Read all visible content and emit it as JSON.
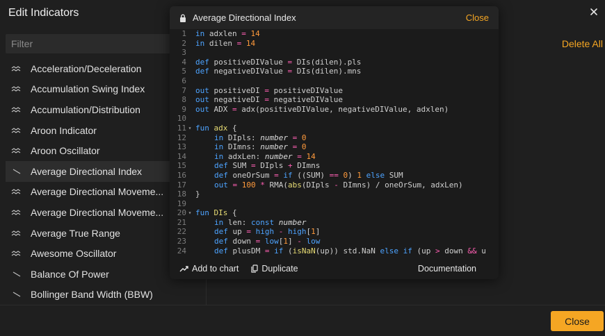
{
  "dialog": {
    "title": "Edit Indicators",
    "delete_all": "Delete All",
    "close_label": "Close"
  },
  "filter": {
    "placeholder": "Filter",
    "value": ""
  },
  "indicators": [
    "Acceleration/Deceleration",
    "Accumulation Swing Index",
    "Accumulation/Distribution",
    "Aroon Indicator",
    "Aroon Oscillator",
    "Average Directional Index",
    "Average Directional Moveme...",
    "Average Directional Moveme...",
    "Average True Range",
    "Awesome Oscillator",
    "Balance Of Power",
    "Bollinger Band Width (BBW)"
  ],
  "selected_index": 5,
  "popup": {
    "title": "Average Directional Index",
    "close_label": "Close",
    "footer": {
      "add_to_chart": "Add to chart",
      "duplicate": "Duplicate",
      "documentation": "Documentation"
    }
  },
  "code_lines": [
    {
      "n": "1",
      "fold": false,
      "indent": 0,
      "tokens": [
        [
          "k",
          "in"
        ],
        [
          "i",
          " adxlen "
        ],
        [
          "o",
          "="
        ],
        [
          "i",
          " "
        ],
        [
          "n",
          "14"
        ]
      ]
    },
    {
      "n": "2",
      "fold": false,
      "indent": 0,
      "tokens": [
        [
          "k",
          "in"
        ],
        [
          "i",
          " dilen "
        ],
        [
          "o",
          "="
        ],
        [
          "i",
          " "
        ],
        [
          "n",
          "14"
        ]
      ]
    },
    {
      "n": "3",
      "fold": false,
      "indent": 0,
      "tokens": []
    },
    {
      "n": "4",
      "fold": false,
      "indent": 0,
      "tokens": [
        [
          "k",
          "def"
        ],
        [
          "i",
          " positiveDIValue "
        ],
        [
          "o",
          "="
        ],
        [
          "i",
          " DIs(dilen).pls"
        ]
      ]
    },
    {
      "n": "5",
      "fold": false,
      "indent": 0,
      "tokens": [
        [
          "k",
          "def"
        ],
        [
          "i",
          " negativeDIValue "
        ],
        [
          "o",
          "="
        ],
        [
          "i",
          " DIs(dilen).mns"
        ]
      ]
    },
    {
      "n": "6",
      "fold": false,
      "indent": 0,
      "tokens": []
    },
    {
      "n": "7",
      "fold": false,
      "indent": 0,
      "tokens": [
        [
          "k",
          "out"
        ],
        [
          "i",
          " positiveDI "
        ],
        [
          "o",
          "="
        ],
        [
          "i",
          " positiveDIValue"
        ]
      ]
    },
    {
      "n": "8",
      "fold": false,
      "indent": 0,
      "tokens": [
        [
          "k",
          "out"
        ],
        [
          "i",
          " negativeDI "
        ],
        [
          "o",
          "="
        ],
        [
          "i",
          " negativeDIValue"
        ]
      ]
    },
    {
      "n": "9",
      "fold": false,
      "indent": 0,
      "tokens": [
        [
          "k",
          "out"
        ],
        [
          "i",
          " ADX "
        ],
        [
          "o",
          "="
        ],
        [
          "i",
          " adx(positiveDIValue, negativeDIValue, adxlen)"
        ]
      ]
    },
    {
      "n": "10",
      "fold": false,
      "indent": 0,
      "tokens": []
    },
    {
      "n": "11",
      "fold": true,
      "indent": 0,
      "tokens": [
        [
          "k",
          "fun"
        ],
        [
          "i",
          " "
        ],
        [
          "f",
          "adx"
        ],
        [
          "i",
          " {"
        ]
      ]
    },
    {
      "n": "12",
      "fold": false,
      "indent": 1,
      "tokens": [
        [
          "k",
          "in"
        ],
        [
          "i",
          " DIpls: "
        ],
        [
          "t",
          "number"
        ],
        [
          "i",
          " "
        ],
        [
          "o",
          "="
        ],
        [
          "i",
          " "
        ],
        [
          "n",
          "0"
        ]
      ]
    },
    {
      "n": "13",
      "fold": false,
      "indent": 1,
      "tokens": [
        [
          "k",
          "in"
        ],
        [
          "i",
          " DImns: "
        ],
        [
          "t",
          "number"
        ],
        [
          "i",
          " "
        ],
        [
          "o",
          "="
        ],
        [
          "i",
          " "
        ],
        [
          "n",
          "0"
        ]
      ]
    },
    {
      "n": "14",
      "fold": false,
      "indent": 1,
      "tokens": [
        [
          "k",
          "in"
        ],
        [
          "i",
          " adxLen: "
        ],
        [
          "t",
          "number"
        ],
        [
          "i",
          " "
        ],
        [
          "o",
          "="
        ],
        [
          "i",
          " "
        ],
        [
          "n",
          "14"
        ]
      ]
    },
    {
      "n": "15",
      "fold": false,
      "indent": 1,
      "tokens": [
        [
          "k",
          "def"
        ],
        [
          "i",
          " SUM "
        ],
        [
          "o",
          "="
        ],
        [
          "i",
          " DIpls "
        ],
        [
          "o",
          "+"
        ],
        [
          "i",
          " DImns"
        ]
      ]
    },
    {
      "n": "16",
      "fold": false,
      "indent": 1,
      "tokens": [
        [
          "k",
          "def"
        ],
        [
          "i",
          " oneOrSum "
        ],
        [
          "o",
          "="
        ],
        [
          "i",
          " "
        ],
        [
          "k",
          "if"
        ],
        [
          "i",
          " ((SUM) "
        ],
        [
          "o",
          "=="
        ],
        [
          "i",
          " "
        ],
        [
          "n",
          "0"
        ],
        [
          "i",
          ") "
        ],
        [
          "n",
          "1"
        ],
        [
          "i",
          " "
        ],
        [
          "k",
          "else"
        ],
        [
          "i",
          " SUM"
        ]
      ]
    },
    {
      "n": "17",
      "fold": false,
      "indent": 1,
      "tokens": [
        [
          "k",
          "out"
        ],
        [
          "i",
          " "
        ],
        [
          "o",
          "="
        ],
        [
          "i",
          " "
        ],
        [
          "n",
          "100"
        ],
        [
          "i",
          " "
        ],
        [
          "o",
          "*"
        ],
        [
          "i",
          " RMA("
        ],
        [
          "f",
          "abs"
        ],
        [
          "i",
          "(DIpls "
        ],
        [
          "o",
          "-"
        ],
        [
          "i",
          " DImns) / oneOrSum, adxLen)"
        ]
      ]
    },
    {
      "n": "18",
      "fold": false,
      "indent": 0,
      "tokens": [
        [
          "i",
          "}"
        ]
      ]
    },
    {
      "n": "19",
      "fold": false,
      "indent": 0,
      "tokens": []
    },
    {
      "n": "20",
      "fold": true,
      "indent": 0,
      "tokens": [
        [
          "k",
          "fun"
        ],
        [
          "i",
          " "
        ],
        [
          "f",
          "DIs"
        ],
        [
          "i",
          " {"
        ]
      ]
    },
    {
      "n": "21",
      "fold": false,
      "indent": 1,
      "tokens": [
        [
          "k",
          "in"
        ],
        [
          "i",
          " len: "
        ],
        [
          "k",
          "const"
        ],
        [
          "i",
          " "
        ],
        [
          "t",
          "number"
        ]
      ]
    },
    {
      "n": "22",
      "fold": false,
      "indent": 1,
      "tokens": [
        [
          "k",
          "def"
        ],
        [
          "i",
          " up "
        ],
        [
          "o",
          "="
        ],
        [
          "i",
          " "
        ],
        [
          "k",
          "high"
        ],
        [
          "i",
          " "
        ],
        [
          "o",
          "-"
        ],
        [
          "i",
          " "
        ],
        [
          "k",
          "high"
        ],
        [
          "i",
          "["
        ],
        [
          "n",
          "1"
        ],
        [
          "i",
          "]"
        ]
      ]
    },
    {
      "n": "23",
      "fold": false,
      "indent": 1,
      "tokens": [
        [
          "k",
          "def"
        ],
        [
          "i",
          " down "
        ],
        [
          "o",
          "="
        ],
        [
          "i",
          " "
        ],
        [
          "k",
          "low"
        ],
        [
          "i",
          "["
        ],
        [
          "n",
          "1"
        ],
        [
          "i",
          "] "
        ],
        [
          "o",
          "-"
        ],
        [
          "i",
          " "
        ],
        [
          "k",
          "low"
        ]
      ]
    },
    {
      "n": "24",
      "fold": false,
      "indent": 1,
      "tokens": [
        [
          "k",
          "def"
        ],
        [
          "i",
          " plusDM "
        ],
        [
          "o",
          "="
        ],
        [
          "i",
          " "
        ],
        [
          "k",
          "if"
        ],
        [
          "i",
          " ("
        ],
        [
          "f",
          "isNaN"
        ],
        [
          "i",
          "(up)) std.NaN "
        ],
        [
          "k",
          "else"
        ],
        [
          "i",
          " "
        ],
        [
          "k",
          "if"
        ],
        [
          "i",
          " (up "
        ],
        [
          "o",
          ">"
        ],
        [
          "i",
          " down "
        ],
        [
          "o",
          "&&"
        ],
        [
          "i",
          " u"
        ]
      ]
    }
  ],
  "colors": {
    "accent": "#f5a623",
    "keyword": "#4da3ff",
    "number": "#ff9a3c",
    "operator": "#ff5fb3",
    "function": "#e6db74"
  }
}
